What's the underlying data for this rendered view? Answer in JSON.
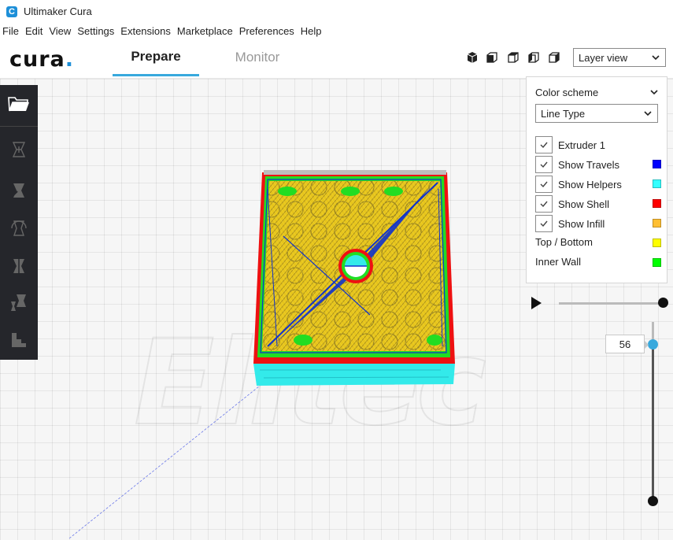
{
  "window": {
    "title": "Ultimaker Cura",
    "app_icon_glyph": "C"
  },
  "menu": [
    "File",
    "Edit",
    "View",
    "Settings",
    "Extensions",
    "Marketplace",
    "Preferences",
    "Help"
  ],
  "header": {
    "logo_text": "cura",
    "logo_dot": ".",
    "tabs": {
      "prepare": "Prepare",
      "monitor": "Monitor"
    },
    "view_buttons": [
      "3d-view-icon",
      "front-view-icon",
      "top-view-icon",
      "left-view-icon",
      "right-view-icon"
    ],
    "view_mode": "Layer view"
  },
  "layer_panel": {
    "color_scheme_label": "Color scheme",
    "color_scheme_value": "Line Type",
    "options": [
      {
        "label": "Extruder 1",
        "checked": true,
        "color": ""
      },
      {
        "label": "Show Travels",
        "checked": true,
        "color": "#0000ff"
      },
      {
        "label": "Show Helpers",
        "checked": true,
        "color": "#33ffff"
      },
      {
        "label": "Show Shell",
        "checked": true,
        "color": "#ff0000"
      },
      {
        "label": "Show Infill",
        "checked": true,
        "color": "#ffbf33"
      }
    ],
    "legend": [
      {
        "label": "Top / Bottom",
        "color": "#ffff00"
      },
      {
        "label": "Inner Wall",
        "color": "#00ff00"
      }
    ]
  },
  "layer_slider": {
    "current_layer": "56"
  },
  "colors": {
    "accent": "#38a9dd",
    "toolbar_bg": "#25262b"
  }
}
